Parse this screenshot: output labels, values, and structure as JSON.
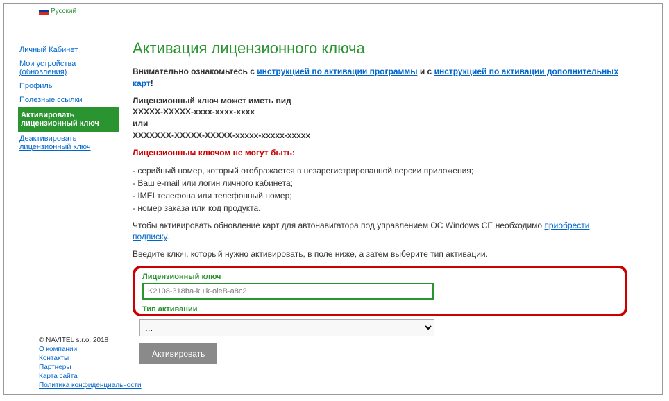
{
  "lang": "Русский",
  "sidebar": {
    "items": [
      {
        "label": "Личный Кабинет"
      },
      {
        "label": "Мои устройства (обновления)"
      },
      {
        "label": "Профиль"
      },
      {
        "label": "Полезные ссылки"
      },
      {
        "label": "Активировать лицензионный ключ"
      },
      {
        "label": "Деактивировать лицензионный ключ"
      }
    ]
  },
  "main": {
    "title": "Активация лицензионного ключа",
    "intro_prefix": "Внимательно ознакомьтесь с ",
    "intro_link1": "инструкцией по активации программы",
    "intro_mid": " и с ",
    "intro_link2": "инструкцией по активации дополнительных карт",
    "intro_suffix": "!",
    "format_heading": "Лицензионный ключ может иметь вид",
    "format1": "XXXXX-XXXXX-xxxx-xxxx-xxxx",
    "format_or": "или",
    "format2": "XXXXXXX-XXXXX-XXXXX-xxxxx-xxxxx-xxxxx",
    "warn": "Лицензионным ключом не могут быть:",
    "note1": "- серийный номер, который отображается в незарегистрированной версии приложения;",
    "note2": "- Ваш e-mail или логин личного кабинета;",
    "note3": "- IMEI телефона или телефонный номер;",
    "note4": "- номер заказа или код продукта.",
    "ce_prefix": "Чтобы активировать обновление карт для автонавигатора под управлением ОС Windows CE необходимо ",
    "ce_link": "приобрести подписку",
    "ce_suffix": ".",
    "enter": "Введите ключ, который нужно активировать, в поле ниже, а затем выберите тип активации.",
    "key_label": "Лицензионный ключ",
    "key_value": "",
    "key_placeholder": "K2108-318ba-kuik-oieB-a8c2",
    "type_label": "Тип активации",
    "type_value": "...",
    "activate": "Активировать"
  },
  "footer": {
    "copyright": "© NAVITEL s.r.o. 2018",
    "links": [
      "О компании",
      "Контакты",
      "Партнеры",
      "Карта сайта",
      "Политика конфиденциальности"
    ]
  }
}
